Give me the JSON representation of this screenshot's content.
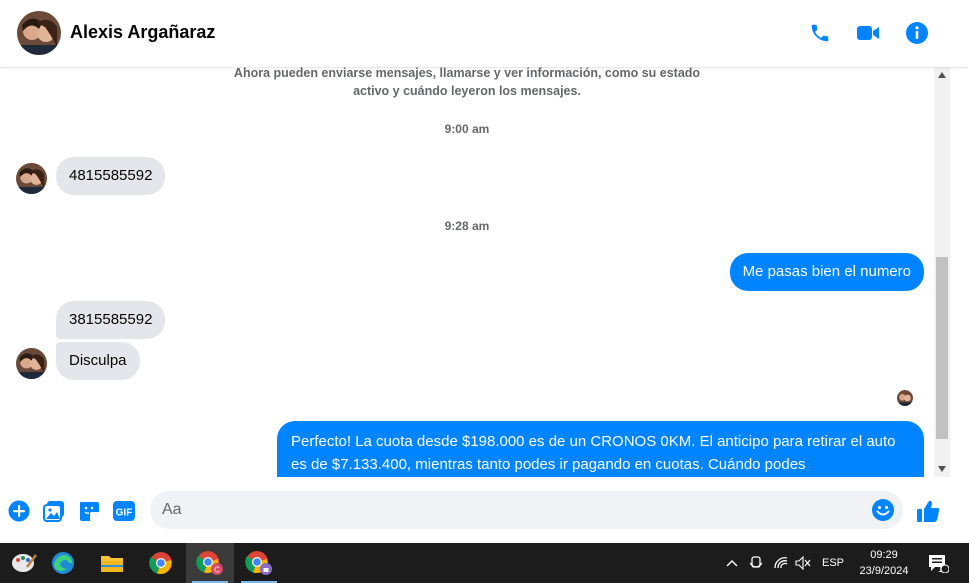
{
  "header": {
    "contact_name": "Alexis Argañaraz",
    "icons": [
      "phone-icon",
      "video-call-icon",
      "info-icon"
    ],
    "accent_color": "#0084ff"
  },
  "conversation": {
    "system_notice": "Ahora pueden enviarse mensajes, llamarse y ver información, como su estado activo y cuándo leyeron los mensajes.",
    "timestamp_1": "9:00 am",
    "msg_in_1": "4815585592",
    "timestamp_2": "9:28 am",
    "msg_out_1": "Me pasas bien el numero",
    "msg_in_2": "3815585592",
    "msg_in_3": "Disculpa",
    "msg_out_2": "Perfecto! La cuota desde $198.000 es de un CRONOS 0KM. El anticipo para retirar el auto es de $7.133.400, mientras tanto podes ir pagando en cuotas. Cuándo podes"
  },
  "composer": {
    "placeholder": "Aa",
    "icons": [
      "plus-icon",
      "photo-icon",
      "sticker-icon",
      "gif-icon",
      "emoji-icon",
      "like-icon"
    ],
    "gif_label": "GIF"
  },
  "taskbar": {
    "apps": [
      "paint-icon",
      "edge-icon",
      "file-explorer-icon",
      "chrome-icon",
      "chrome-profile-c-icon",
      "chrome-profile-lock-icon"
    ],
    "language": "ESP",
    "time": "09:29",
    "date": "23/9/2024",
    "notification_count": "1"
  }
}
